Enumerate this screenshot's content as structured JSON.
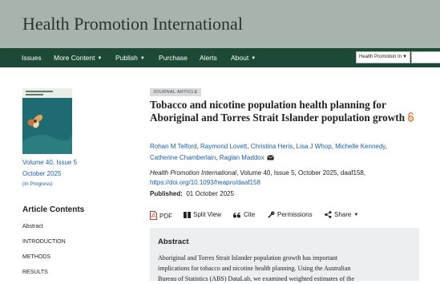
{
  "header": {
    "journal_title": "Health Promotion International"
  },
  "nav": {
    "items": [
      "Issues",
      "More Content",
      "Publish",
      "Purchase",
      "Alerts",
      "About"
    ],
    "search_scope": "Health Promotion In"
  },
  "sidebar": {
    "volume": "Volume 40, Issue 5",
    "date": "October 2025",
    "status": "(In Progress)",
    "contents_heading": "Article Contents",
    "toc": [
      "Abstract",
      "INTRODUCTION",
      "METHODS",
      "RESULTS"
    ]
  },
  "article": {
    "type": "JOURNAL ARTICLE",
    "title": "Tobacco and nicotine population health planning for Aboriginal and Torres Strait Islander population growth",
    "authors": [
      "Rohan M Telford",
      "Raymond Lovett",
      "Christina Heris",
      "Lisa J Whop",
      "Michelle Kennedy",
      "Catherine Chamberlain",
      "Raglan Maddox"
    ],
    "citation_journal": "Health Promotion International",
    "citation_rest": ", Volume 40, Issue 5, October 2025, daaf158,",
    "doi": "https://doi.org/10.1093/heapro/daaf158",
    "published_label": "Published:",
    "published_date": "01 October 2025"
  },
  "toolbar": {
    "pdf": "PDF",
    "split_view": "Split View",
    "cite": "Cite",
    "permissions": "Permissions",
    "share": "Share"
  },
  "abstract": {
    "heading": "Abstract",
    "line1": "Aboriginal and Torres Strait Islander population growth has important",
    "line2": "implications for tobacco and nicotine health planning. Using the Australian",
    "line3": "Bureau of Statistics (ABS) DataLab, we examined weighted estimates of the"
  },
  "colors": {
    "banner": "#a7b4ac",
    "nav": "#1c4a36",
    "link": "#1a5fa8",
    "oa": "#e8742a"
  }
}
